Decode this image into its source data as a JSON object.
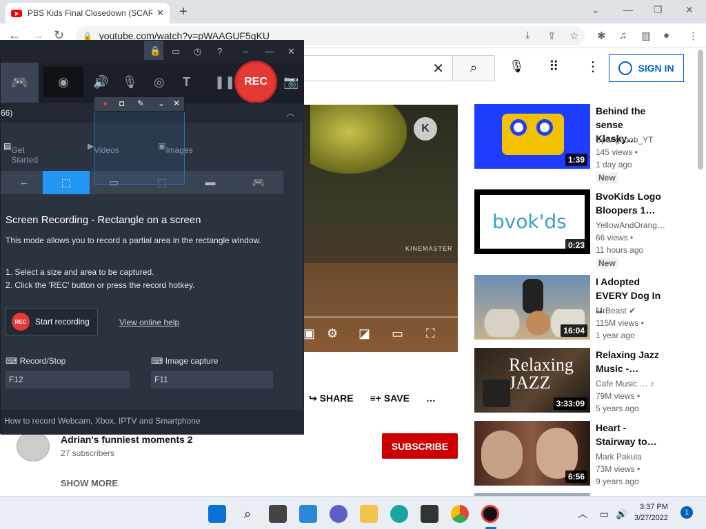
{
  "browser": {
    "tab_title": "PBS Kids Final Closedown (SCAR…",
    "url": "youtube.com/watch?v=pWAAGUF5qKU"
  },
  "youtube": {
    "sign_in": "SIGN IN",
    "actions": {
      "share": "SHARE",
      "save": "SAVE",
      "more": "…"
    },
    "channel": {
      "name": "Adrian's funniest moments 2",
      "subscribers": "27 subscribers"
    },
    "subscribe": "SUBSCRIBE",
    "show_more": "SHOW MORE",
    "video_watermark": "KINEMASTER",
    "recommendations": [
      {
        "title": "Behind the sense Klasky…",
        "channel": "Spongebob_YT",
        "views": "145 views •",
        "age": "1 day ago",
        "badge": "New",
        "duration": "1:39",
        "color": "#1e3cff"
      },
      {
        "title": "BvoKids Logo Bloopers 1…",
        "channel": "YellowAndOrang…",
        "views": "66 views •",
        "age": "11 hours ago",
        "badge": "New",
        "duration": "0:23",
        "color": "#ffffff",
        "thumb_text": "bvok'ds"
      },
      {
        "title": "I Adopted EVERY Dog In …",
        "channel": "MrBeast",
        "views": "115M views •",
        "age": "1 year ago",
        "badge": "",
        "duration": "16:04",
        "color": "#6a8fb5"
      },
      {
        "title": "Relaxing Jazz Music -…",
        "channel": "Cafe Music …",
        "views": "79M views •",
        "age": "5 years ago",
        "badge": "",
        "duration": "3:33:09",
        "color": "#3a3028",
        "thumb_text": "Relaxing JAZZ"
      },
      {
        "title": "Heart - Stairway to…",
        "channel": "Mark Pakula",
        "views": "73M views •",
        "age": "9 years ago",
        "badge": "",
        "duration": "6:56",
        "color": "#6b3a2a"
      }
    ]
  },
  "recorder": {
    "section_number": "66)",
    "rec_label": "REC",
    "tabs": {
      "get_started": "Get Started",
      "videos": "Videos",
      "images": "Images"
    },
    "mode_title": "Screen Recording - Rectangle on a screen",
    "mode_desc": "This mode allows you to record a partial area in the rectangle window.",
    "step1": "1. Select a size and area to be captured.",
    "step2": "2. Click the 'REC' button or press the record hotkey.",
    "start_recording": "Start recording",
    "start_rec_badge": "REC",
    "view_help": "View online help",
    "hotkeys": {
      "record_label": "Record/Stop",
      "record_value": "F12",
      "image_label": "Image capture",
      "image_value": "F11"
    },
    "footer": "How to record Webcam, Xbox, IPTV and Smartphone"
  },
  "taskbar": {
    "time": "3:37 PM",
    "date": "3/27/2022",
    "notifications": "1"
  }
}
